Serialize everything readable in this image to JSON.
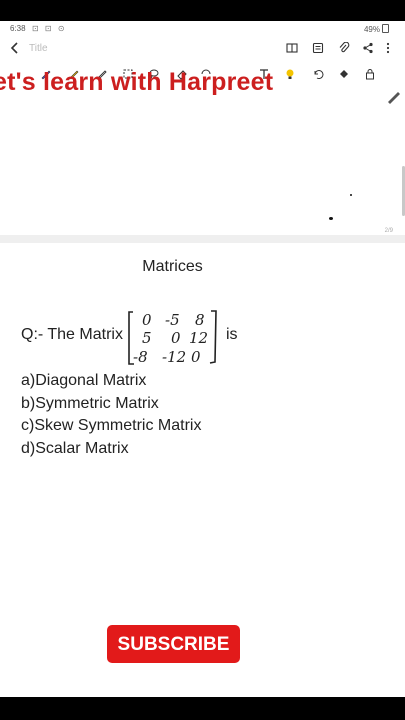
{
  "status_bar": {
    "time": "6:38",
    "icons": "⊡ ⊡ ⊙",
    "battery": "49%"
  },
  "toolbar": {
    "title_placeholder": "Title"
  },
  "banner": {
    "text": "et's learn with Harpreet"
  },
  "page": {
    "page_indicator": "2/9"
  },
  "content": {
    "heading": "Matrices",
    "question_prefix": "Q:- The Matrix",
    "question_suffix": "is",
    "matrix": {
      "rows": [
        [
          "0",
          "-5",
          "8"
        ],
        [
          "5",
          "0",
          "12"
        ],
        [
          "-8",
          "-12",
          "0"
        ]
      ]
    },
    "options": [
      "a)Diagonal Matrix",
      "b)Symmetric Matrix",
      "c)Skew Symmetric Matrix",
      "d)Scalar Matrix"
    ]
  },
  "subscribe": {
    "label": "SUBSCRIBE",
    "color": "#e21a1a"
  },
  "colors": {
    "banner": "#cc1f1f",
    "ink": "#222222"
  }
}
